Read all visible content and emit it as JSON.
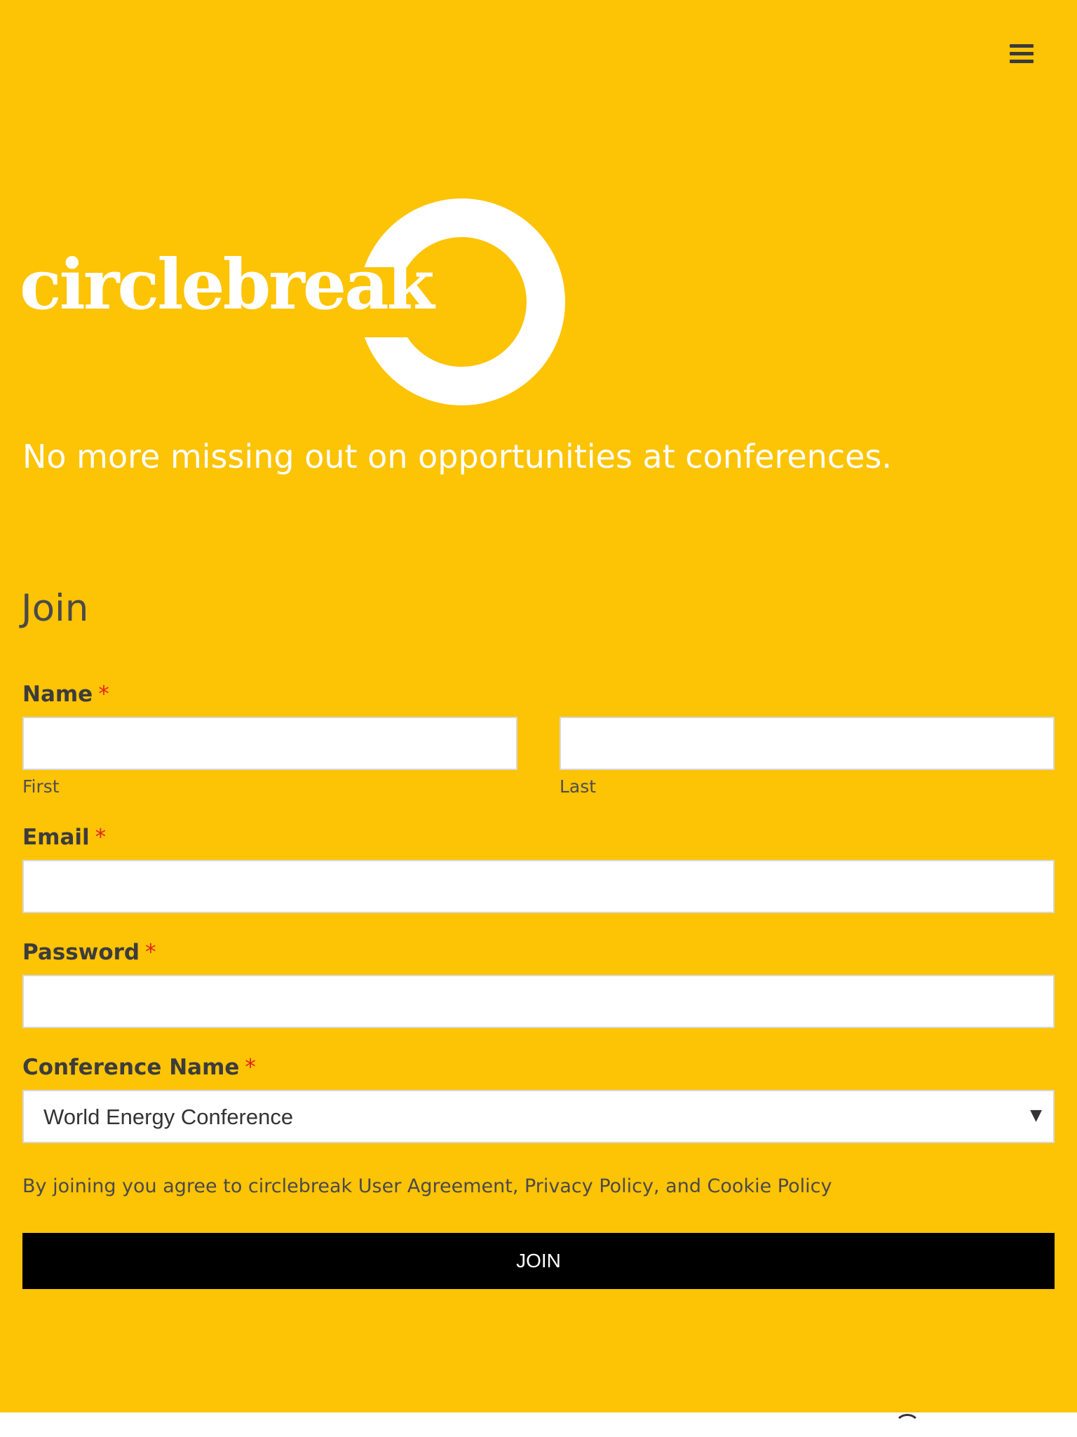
{
  "colors": {
    "background": "#FDC305",
    "text_dark": "#3c3c3c",
    "required": "#e2261f",
    "button": "#000000",
    "button_text": "#ffffff"
  },
  "header": {
    "menu_icon": "hamburger-menu-icon"
  },
  "brand": {
    "logo_text": "circlebreak",
    "tagline": "No more missing out on opportunities at conferences."
  },
  "form": {
    "heading": "Join",
    "required_mark": "*",
    "name": {
      "label": "Name",
      "first": {
        "value": "",
        "sub_label": "First"
      },
      "last": {
        "value": "",
        "sub_label": "Last"
      }
    },
    "email": {
      "label": "Email",
      "value": ""
    },
    "password": {
      "label": "Password",
      "value": ""
    },
    "conference": {
      "label": "Conference Name",
      "selected": "World Energy Conference",
      "arrow_icon": "dropdown-arrow-icon"
    },
    "agreement": "By joining you agree to circlebreak User Agreement, Privacy Policy, and Cookie Policy",
    "submit_label": "JOIN"
  }
}
